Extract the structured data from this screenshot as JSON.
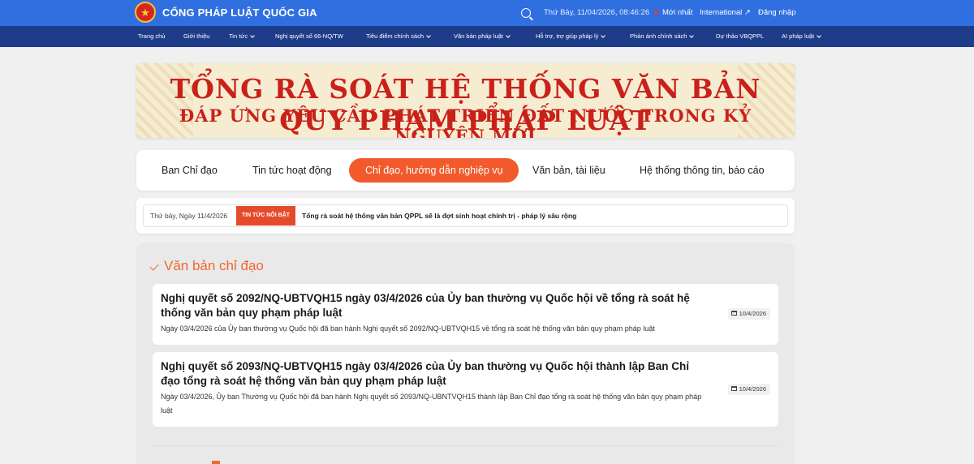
{
  "header": {
    "site_title": "CỔNG PHÁP LUẬT QUỐC GIA",
    "datetime": "Thứ Bảy, 11/04/2026, 08:46:26",
    "new_label": "Mới nhất",
    "international_label": "International ↗",
    "login_label": "Đăng nhập"
  },
  "nav": {
    "items": [
      {
        "label": "Trang chủ"
      },
      {
        "label": "Giới thiệu"
      },
      {
        "label": "Tin tức"
      },
      {
        "label": "Nghị quyết số 66-NQ/TW"
      },
      {
        "label": "Tiêu điểm chính sách"
      },
      {
        "label": "Văn bản pháp luật"
      },
      {
        "label": "Hỗ trợ, trợ giúp pháp lý"
      },
      {
        "label": "Phản ánh chính sách"
      },
      {
        "label": "Dự thảo VBQPPL"
      },
      {
        "label": "AI pháp luật"
      }
    ]
  },
  "banner": {
    "line1": "TỔNG RÀ SOÁT HỆ THỐNG VĂN BẢN QUY PHẠM PHÁP LUẬT",
    "line2": "ĐÁP ỨNG YÊU CẦU PHÁT TRIỂN ĐẤT NƯỚC TRONG KỶ NGUYÊN MỚI"
  },
  "tabs": [
    {
      "label": "Ban Chỉ đạo",
      "active": false
    },
    {
      "label": "Tin tức hoạt động",
      "active": false
    },
    {
      "label": "Chỉ đạo, hướng dẫn nghiệp vụ",
      "active": true
    },
    {
      "label": "Văn bản, tài liệu",
      "active": false
    },
    {
      "label": "Hệ thống thông tin, báo cáo",
      "active": false
    }
  ],
  "ticker": {
    "date": "Thứ bảy, Ngày 11/4/2026",
    "badge": "TIN TỨC NỔI BẬT",
    "headline": "Tổng rà soát hệ thống văn bản QPPL sẽ là đợt sinh hoạt chính trị - pháp lý sâu rộng"
  },
  "section": {
    "title": "Văn bản chỉ đạo",
    "items": [
      {
        "title": "Nghị quyết số 2092/NQ-UBTVQH15 ngày 03/4/2026 của Ủy ban thường vụ Quốc hội về tổng rà soát hệ thống văn bản quy phạm pháp luật",
        "desc": "Ngày 03/4/2026 của Ủy ban thường vụ Quốc hội đã ban hành Nghị quyết số 2092/NQ-UBTVQH15 về tổng rà soát hệ thống văn bản quy phạm pháp luật",
        "date": "10/4/2026"
      },
      {
        "title": "Nghị quyết số 2093/NQ-UBTVQH15 ngày 03/4/2026 của Ủy ban thường vụ Quốc hội thành lập Ban Chỉ đạo tổng rà soát hệ thống văn bản quy phạm pháp luật",
        "desc": "Ngày 03/4/2026, Ủy ban Thường vụ Quốc hội đã ban hành Nghị quyết số 2093/NQ-UBNTVQH15 thành lập Ban Chỉ đạo tổng rà soát hệ thống văn bản quy phạm pháp luật",
        "date": "10/4/2026"
      }
    ]
  },
  "colors": {
    "topbar": "#2f6fe0",
    "navbar": "#1f3c8a",
    "accent": "#f25a2b",
    "banner_text": "#c9211a"
  }
}
